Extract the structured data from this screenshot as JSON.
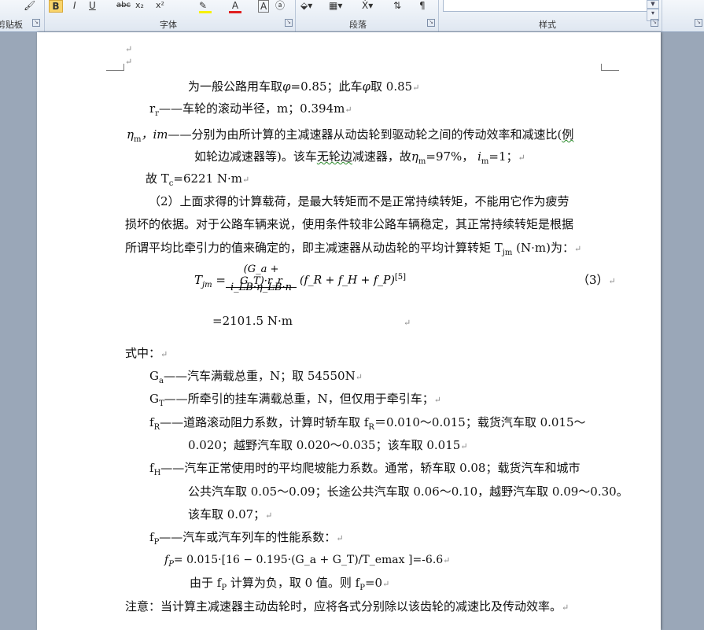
{
  "ribbon": {
    "groups": {
      "clipboard": "剪贴板",
      "font": "字体",
      "paragraph": "段落",
      "styles": "样式"
    },
    "icons": [
      "paste-icon",
      "bold-icon",
      "italic-icon",
      "underline-icon",
      "strikethrough-icon",
      "highlight-icon",
      "font-color-icon",
      "character-border-icon",
      "shading-icon",
      "borders-icon",
      "sort-icon",
      "show-marks-icon"
    ]
  },
  "doc": {
    "l1": "为一般公路用车取",
    "l1b": "φ",
    "l1c": "=0.85；此车",
    "l1d": "φ",
    "l1e": "取 0.85",
    "l2a": "r",
    "l2sub": "r",
    "l2b": "——车轮的滚动半径，m；0.394m",
    "l3sym1": "η",
    "l3sym1sub": "m",
    "l3sym2": "，im",
    "l3b": "——分别为由所计算的主减速器从动齿轮到驱动轮之间的传动效率和减速比(",
    "l3c": "例",
    "l4a": "如轮边减速器等)。该车",
    "l4b": "无轮边",
    "l4c": "减速器，故",
    "l4eta": "η",
    "l4etasub": "m",
    "l4d": "=97%，",
    "l4i": "i",
    "l4isub": "m",
    "l4e": "=1；",
    "l5a": "故 T",
    "l5sub": "c",
    "l5b": "=6221 N·m",
    "p2_1": "（2）上面求得的计算载荷，是最大转矩而不是正常持续转矩，不能用它作为疲劳",
    "p2_2": "损坏的依据。对于公路车辆来说，使用条件较非公路车辆稳定，其正常持续转矩是根据",
    "p2_3": "所谓平均比牵引力的值来确定的，即主减速器从动齿轮的平均计算转矩 T",
    "p2_3sub": "jm",
    "p2_3b": " (N·m)为：",
    "eq_lhs": "T",
    "eq_lhs_sub": "jm",
    "eq_num": "(G_a + G_T)·r_r",
    "eq_den": "i_LB·η_LB·n",
    "eq_rest": "(f_R + f_H + f_P)",
    "eq_ref": "[5]",
    "eq_no": "（3）",
    "eq_val": "=2101.5 N·m",
    "where": "式中：",
    "ga_a": "G",
    "ga_sub": "a",
    "ga_b": "——汽车满载总重，N；取 54550N",
    "gt_a": "G",
    "gt_sub": "T",
    "gt_b": "——所牵引的挂车满载总重，N，但仅用于牵引车；",
    "fr_a": "f",
    "fr_sub": "R",
    "fr_b": "——道路滚动阻力系数，计算时轿车取  f",
    "fr_sub2": "R",
    "fr_c": "＝0.010～0.015；载货汽车取  0.015～",
    "fr_2": "0.020；越野汽车取 0.020～0.035；该车取 0.015",
    "fh_a": "f",
    "fh_sub": "H",
    "fh_b": "——汽车正常使用时的平均爬坡能力系数。通常，轿车取 0.08；载货汽车和城市",
    "fh_2": "公共汽车取 0.05～0.09；长途公共汽车取 0.06～0.10，越野汽车取 0.09～0.30。",
    "fh_3": "该车取 0.07；",
    "fp_a": "f",
    "fp_sub": "P",
    "fp_b": "——汽车或汽车列车的性能系数：",
    "fp_eq": "= 0.015·[16 − 0.195·(G_a + G_T)/T_emax ]=-6.6",
    "fp_neg_a": "由于 f",
    "fp_neg_sub": "P",
    "fp_neg_b": " 计算为负，取 0 值。则 f",
    "fp_neg_sub2": "P",
    "fp_neg_c": "=0",
    "note": "注意：当计算主减速器主动齿轮时，应将各式分别除以该齿轮的减速比及传动效率。",
    "para_mark": "↵"
  }
}
